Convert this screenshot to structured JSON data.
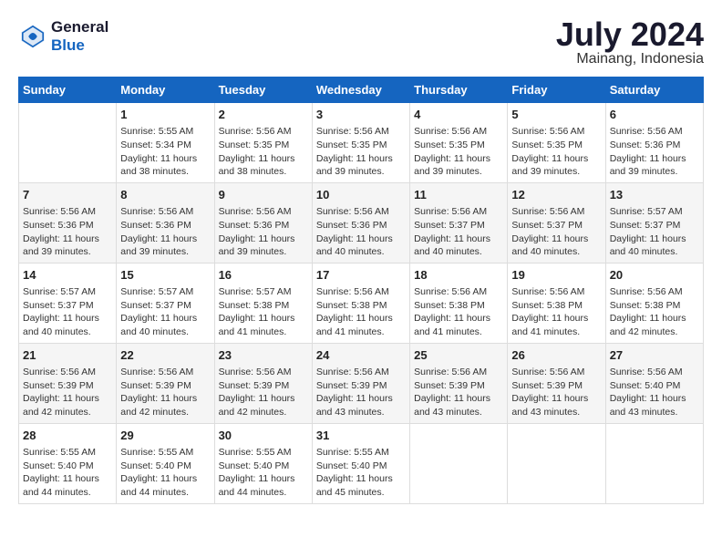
{
  "header": {
    "logo_line1": "General",
    "logo_line2": "Blue",
    "month": "July 2024",
    "location": "Mainang, Indonesia"
  },
  "days_of_week": [
    "Sunday",
    "Monday",
    "Tuesday",
    "Wednesday",
    "Thursday",
    "Friday",
    "Saturday"
  ],
  "weeks": [
    [
      {
        "day": "",
        "info": ""
      },
      {
        "day": "1",
        "info": "Sunrise: 5:55 AM\nSunset: 5:34 PM\nDaylight: 11 hours\nand 38 minutes."
      },
      {
        "day": "2",
        "info": "Sunrise: 5:56 AM\nSunset: 5:35 PM\nDaylight: 11 hours\nand 38 minutes."
      },
      {
        "day": "3",
        "info": "Sunrise: 5:56 AM\nSunset: 5:35 PM\nDaylight: 11 hours\nand 39 minutes."
      },
      {
        "day": "4",
        "info": "Sunrise: 5:56 AM\nSunset: 5:35 PM\nDaylight: 11 hours\nand 39 minutes."
      },
      {
        "day": "5",
        "info": "Sunrise: 5:56 AM\nSunset: 5:35 PM\nDaylight: 11 hours\nand 39 minutes."
      },
      {
        "day": "6",
        "info": "Sunrise: 5:56 AM\nSunset: 5:36 PM\nDaylight: 11 hours\nand 39 minutes."
      }
    ],
    [
      {
        "day": "7",
        "info": "Sunrise: 5:56 AM\nSunset: 5:36 PM\nDaylight: 11 hours\nand 39 minutes."
      },
      {
        "day": "8",
        "info": "Sunrise: 5:56 AM\nSunset: 5:36 PM\nDaylight: 11 hours\nand 39 minutes."
      },
      {
        "day": "9",
        "info": "Sunrise: 5:56 AM\nSunset: 5:36 PM\nDaylight: 11 hours\nand 39 minutes."
      },
      {
        "day": "10",
        "info": "Sunrise: 5:56 AM\nSunset: 5:36 PM\nDaylight: 11 hours\nand 40 minutes."
      },
      {
        "day": "11",
        "info": "Sunrise: 5:56 AM\nSunset: 5:37 PM\nDaylight: 11 hours\nand 40 minutes."
      },
      {
        "day": "12",
        "info": "Sunrise: 5:56 AM\nSunset: 5:37 PM\nDaylight: 11 hours\nand 40 minutes."
      },
      {
        "day": "13",
        "info": "Sunrise: 5:57 AM\nSunset: 5:37 PM\nDaylight: 11 hours\nand 40 minutes."
      }
    ],
    [
      {
        "day": "14",
        "info": "Sunrise: 5:57 AM\nSunset: 5:37 PM\nDaylight: 11 hours\nand 40 minutes."
      },
      {
        "day": "15",
        "info": "Sunrise: 5:57 AM\nSunset: 5:37 PM\nDaylight: 11 hours\nand 40 minutes."
      },
      {
        "day": "16",
        "info": "Sunrise: 5:57 AM\nSunset: 5:38 PM\nDaylight: 11 hours\nand 41 minutes."
      },
      {
        "day": "17",
        "info": "Sunrise: 5:56 AM\nSunset: 5:38 PM\nDaylight: 11 hours\nand 41 minutes."
      },
      {
        "day": "18",
        "info": "Sunrise: 5:56 AM\nSunset: 5:38 PM\nDaylight: 11 hours\nand 41 minutes."
      },
      {
        "day": "19",
        "info": "Sunrise: 5:56 AM\nSunset: 5:38 PM\nDaylight: 11 hours\nand 41 minutes."
      },
      {
        "day": "20",
        "info": "Sunrise: 5:56 AM\nSunset: 5:38 PM\nDaylight: 11 hours\nand 42 minutes."
      }
    ],
    [
      {
        "day": "21",
        "info": "Sunrise: 5:56 AM\nSunset: 5:39 PM\nDaylight: 11 hours\nand 42 minutes."
      },
      {
        "day": "22",
        "info": "Sunrise: 5:56 AM\nSunset: 5:39 PM\nDaylight: 11 hours\nand 42 minutes."
      },
      {
        "day": "23",
        "info": "Sunrise: 5:56 AM\nSunset: 5:39 PM\nDaylight: 11 hours\nand 42 minutes."
      },
      {
        "day": "24",
        "info": "Sunrise: 5:56 AM\nSunset: 5:39 PM\nDaylight: 11 hours\nand 43 minutes."
      },
      {
        "day": "25",
        "info": "Sunrise: 5:56 AM\nSunset: 5:39 PM\nDaylight: 11 hours\nand 43 minutes."
      },
      {
        "day": "26",
        "info": "Sunrise: 5:56 AM\nSunset: 5:39 PM\nDaylight: 11 hours\nand 43 minutes."
      },
      {
        "day": "27",
        "info": "Sunrise: 5:56 AM\nSunset: 5:40 PM\nDaylight: 11 hours\nand 43 minutes."
      }
    ],
    [
      {
        "day": "28",
        "info": "Sunrise: 5:55 AM\nSunset: 5:40 PM\nDaylight: 11 hours\nand 44 minutes."
      },
      {
        "day": "29",
        "info": "Sunrise: 5:55 AM\nSunset: 5:40 PM\nDaylight: 11 hours\nand 44 minutes."
      },
      {
        "day": "30",
        "info": "Sunrise: 5:55 AM\nSunset: 5:40 PM\nDaylight: 11 hours\nand 44 minutes."
      },
      {
        "day": "31",
        "info": "Sunrise: 5:55 AM\nSunset: 5:40 PM\nDaylight: 11 hours\nand 45 minutes."
      },
      {
        "day": "",
        "info": ""
      },
      {
        "day": "",
        "info": ""
      },
      {
        "day": "",
        "info": ""
      }
    ]
  ]
}
